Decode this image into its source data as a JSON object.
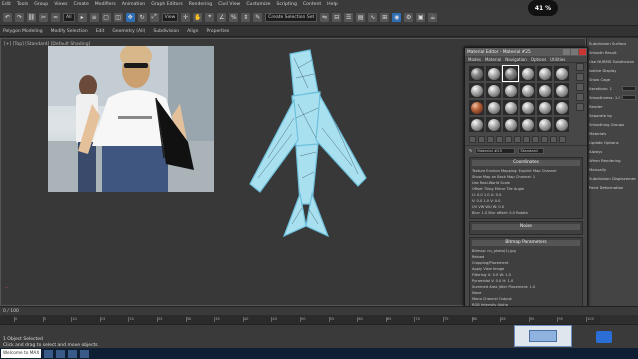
{
  "menubar": {
    "items": [
      "Edit",
      "Tools",
      "Group",
      "Views",
      "Create",
      "Modifiers",
      "Animation",
      "Graph Editors",
      "Rendering",
      "Civil View",
      "Customize",
      "Scripting",
      "Content",
      "Help"
    ]
  },
  "toolbar": {
    "selection_filter": "All",
    "view_dropdown": "View",
    "named_selection": "Create Selection Set"
  },
  "ribbon": {
    "items": [
      "Polygon Modeling",
      "Modify Selection",
      "Edit",
      "Geometry (All)",
      "Subdivision",
      "Align",
      "Properties"
    ]
  },
  "clock": {
    "value": "41",
    "unit": "%"
  },
  "viewport": {
    "label": "[+] [Top] [Standard] [Default Shading]"
  },
  "material_editor": {
    "title": "Material Editor - Material #25",
    "menu": [
      "Modes",
      "Material",
      "Navigation",
      "Options",
      "Utilities"
    ],
    "material_name": "Material #25",
    "material_type": "Standard",
    "rollouts": [
      {
        "title": "Coordinates",
        "lines": [
          "Texture  Environ  Mapping: Explicit Map Channel",
          "Show Map on Back  Map Channel: 1",
          "Use Real-World Scale",
          "Offset  Tiling  Mirror Tile  Angle",
          "U: 0.0  1.0  U: 0.0",
          "V: 0.0  1.0  V: 0.0",
          "UV  VW  WU  W: 0.0",
          "Blur: 1.0  Blur offset: 0.0  Rotate"
        ]
      },
      {
        "title": "Noise",
        "lines": []
      },
      {
        "title": "Bitmap Parameters",
        "lines": [
          "Bitmap:  nn_photo(1).jpg",
          "Reload",
          "Cropping/Placement",
          "Apply  View Image",
          "Filtering  U: 0.0  W: 1.0",
          "Pyramidal  V: 0.0  H: 1.0",
          "Summed Area  Jitter Placement: 1.0",
          "None",
          "Mono Channel Output:",
          "RGB Intensity  Alpha"
        ]
      }
    ]
  },
  "command_panel": {
    "items": [
      "Subdivision Surface",
      "Smooth Result",
      "Use NURMS Subdivision",
      "Isoline Display",
      "Show Cage",
      "Iterations: 1",
      "Smoothness: 1.0",
      "Render",
      "Separate by",
      "Smoothing Groups",
      "Materials",
      "Update Options",
      "Always",
      "When Rendering",
      "Manually",
      "Subdivision Displacement",
      "Paint Deformation"
    ]
  },
  "timeline": {
    "frame": "0 / 100"
  },
  "track": {
    "ticks": [
      "0",
      "5",
      "10",
      "15",
      "20",
      "25",
      "30",
      "35",
      "40",
      "45",
      "50",
      "55",
      "60",
      "65",
      "70",
      "75",
      "80",
      "85",
      "90",
      "95",
      "100"
    ]
  },
  "status": {
    "selected": "1 Object Selected",
    "prompt": "Click and drag to select and move objects"
  },
  "taskbar": {
    "start_label": "Welcome to MAX"
  },
  "colors": {
    "accent": "#2f6db5",
    "mesh": "#a8e0f0",
    "mesh_edge": "#6ec0dc",
    "close": "#cc3333"
  }
}
